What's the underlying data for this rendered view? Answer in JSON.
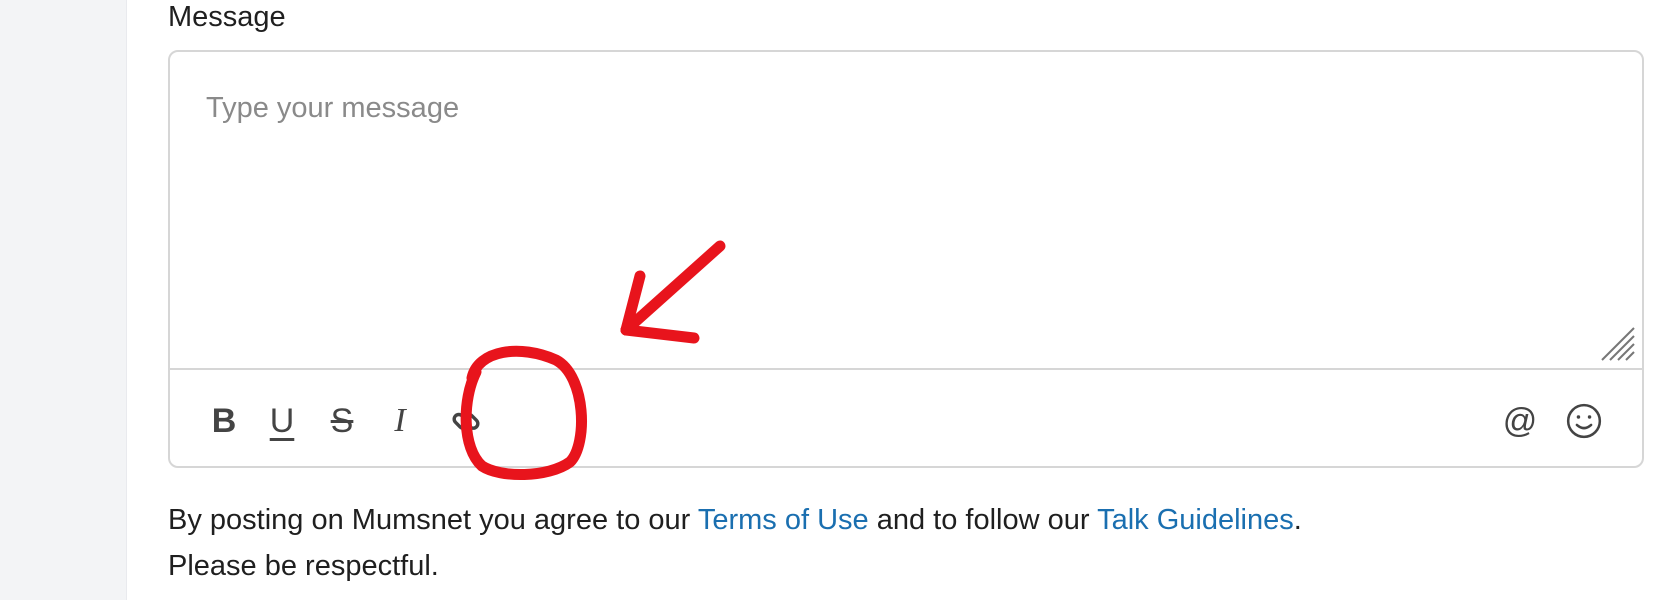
{
  "form": {
    "label": "Message",
    "placeholder": "Type your message"
  },
  "toolbar": {
    "bold": "B",
    "underline": "U",
    "strike": "S",
    "italic": "I",
    "mention": "@"
  },
  "footer": {
    "prefix": "By posting on Mumsnet you agree to our ",
    "terms_link": "Terms of Use",
    "middle": " and to follow our ",
    "guidelines_link": "Talk Guidelines",
    "suffix": ".",
    "line2": "Please be respectful."
  },
  "colors": {
    "link": "#1a6fb0",
    "annotation": "#e8141c"
  }
}
